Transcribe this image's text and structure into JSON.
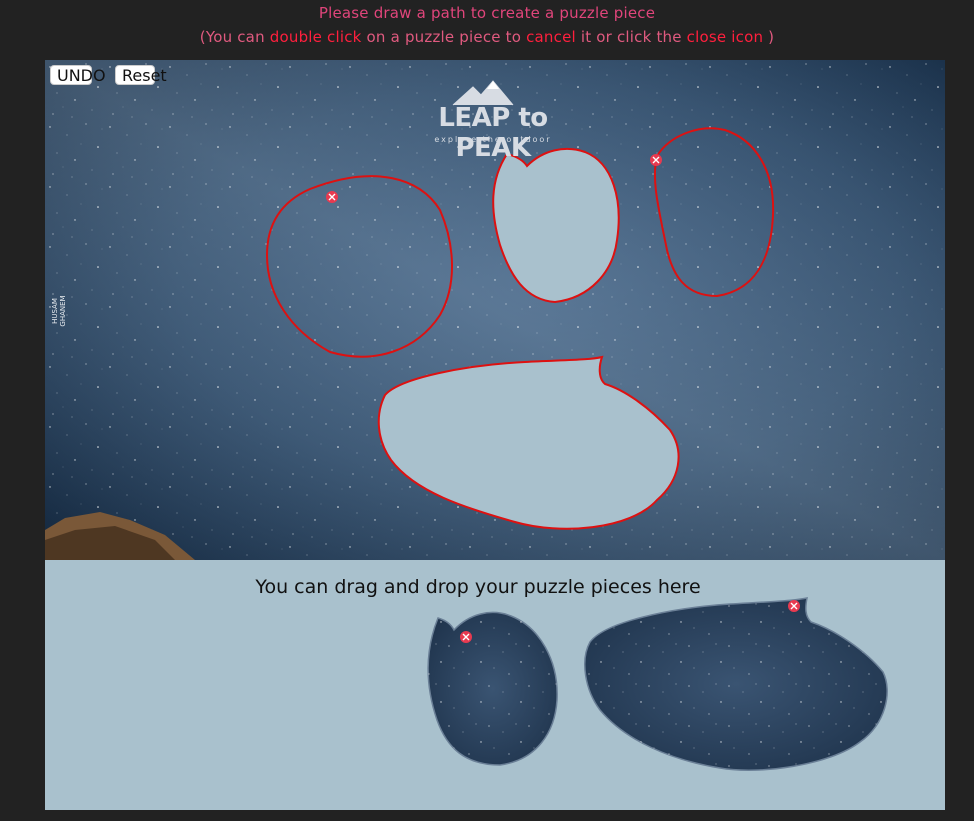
{
  "instructions": {
    "line1": "Please draw a path to create a puzzle piece",
    "line2_prefix": "(You can ",
    "line2_action1": "double click",
    "line2_mid1": " on a puzzle piece to ",
    "line2_action2": "cancel",
    "line2_mid2": " it or click the ",
    "line2_action3": "close icon",
    "line2_suffix": " )"
  },
  "toolbar": {
    "undo_label": "UNDO",
    "reset_label": "Reset"
  },
  "image": {
    "logo_text": "LEAP to PEAK",
    "logo_subtitle": "explore the outdoor",
    "watermark_text": "HUSAM GHANEM"
  },
  "tray": {
    "hint": "You can drag and drop your puzzle pieces here"
  },
  "colors": {
    "background": "#222222",
    "instruction_text": "#e0457b",
    "highlight": "#ff1f3d",
    "outline": "#dd1111",
    "cutout_fill": "#a9c1cd",
    "tray_bg": "#a9c1cd",
    "close_icon": "#e83a50"
  },
  "icons": {
    "close": "close-icon"
  }
}
